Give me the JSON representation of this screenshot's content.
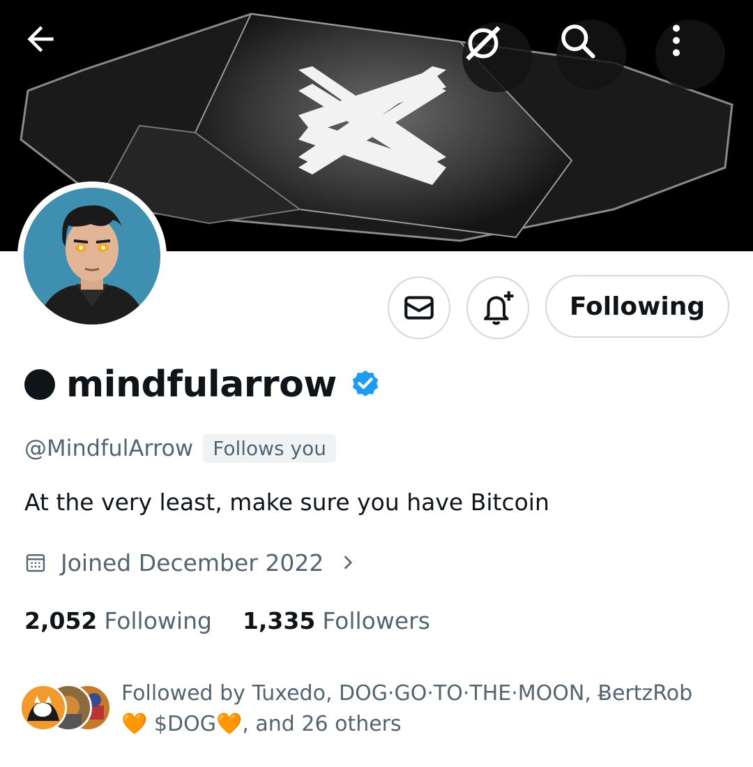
{
  "header": {
    "back_icon": "arrow-left-icon",
    "grok_icon": "slash-circle-icon",
    "search_icon": "search-icon",
    "more_icon": "more-vertical-icon"
  },
  "profile": {
    "display_name": "mindfularrow",
    "handle": "@MindfulArrow",
    "follows_you": "Follows you",
    "bio": "At the very least, make sure you have Bitcoin",
    "joined": "Joined December 2022",
    "verified_color": "#1d9bf0"
  },
  "actions": {
    "message_icon": "envelope-icon",
    "notify_icon": "bell-plus-icon",
    "following_label": "Following"
  },
  "stats": {
    "following_count": "2,052",
    "following_label": "Following",
    "followers_count": "1,335",
    "followers_label": "Followers"
  },
  "followed_by": {
    "line1": "Followed by Tuxedo, DOG·GO·TO·THE·MOON, ɃertzRob",
    "emoji": "🧡",
    "token": "$DOG",
    "suffix": ", and 26 others"
  }
}
